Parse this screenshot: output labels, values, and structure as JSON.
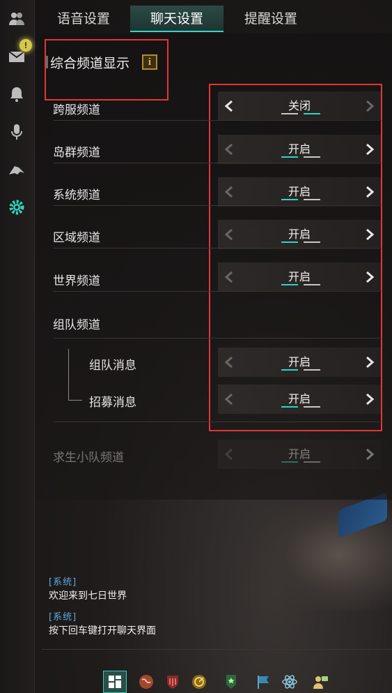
{
  "tabs": [
    {
      "label": "语音设置",
      "active": false
    },
    {
      "label": "聊天设置",
      "active": true
    },
    {
      "label": "提醒设置",
      "active": false
    }
  ],
  "sidebar": {
    "icons": [
      "friends-icon",
      "mail-icon",
      "bell-icon",
      "microphone-icon",
      "bird-icon",
      "gear-icon"
    ],
    "mail_badge": "!"
  },
  "section": {
    "title": "综合频道显示",
    "info_icon": "i"
  },
  "rows": [
    {
      "label": "跨服频道",
      "value": "关闭",
      "state": "off"
    },
    {
      "label": "岛群频道",
      "value": "开启",
      "state": "on"
    },
    {
      "label": "系统频道",
      "value": "开启",
      "state": "on"
    },
    {
      "label": "区域频道",
      "value": "开启",
      "state": "on"
    },
    {
      "label": "世界频道",
      "value": "开启",
      "state": "on"
    },
    {
      "label": "组队频道"
    },
    {
      "label": "组队消息",
      "value": "开启",
      "state": "on"
    },
    {
      "label": "招募消息",
      "value": "开启",
      "state": "on"
    },
    {
      "label": "求生小队频道",
      "value": "开启",
      "state": "on"
    }
  ],
  "chat": [
    {
      "tag": "[系统]",
      "text": "欢迎来到七日世界"
    },
    {
      "tag": "[系统]",
      "text": "按下回车键打开聊天界面"
    }
  ],
  "bottom_bar": {
    "icons": [
      "layout-icon",
      "globe-icon",
      "shield-icon",
      "radar-icon",
      "badge-icon",
      "flag-icon",
      "atom-icon",
      "user-chat-icon"
    ]
  },
  "colors": {
    "accent": "#2ed6bf",
    "highlight_box": "#e53535",
    "info": "#e0b040",
    "chat_tag": "#5fa8e0"
  }
}
